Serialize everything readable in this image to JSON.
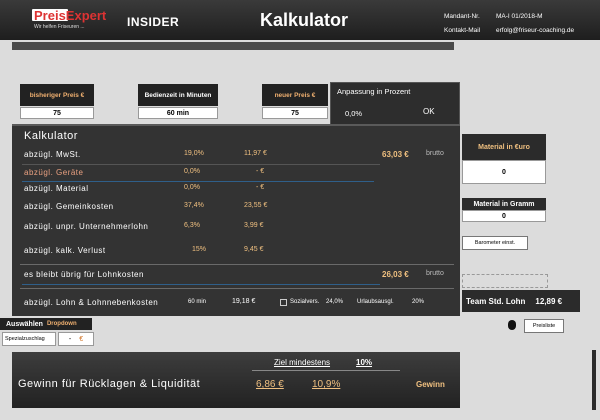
{
  "header": {
    "logo_text": "PreisExpert",
    "logo_tagline": "Wir helfen Friseuren ...",
    "insider": "INSIDER",
    "title": "Kalkulator",
    "mandant_label": "Mandant-Nr.",
    "mandant_value": "MA-I 01/2018-M",
    "contact_label": "Kontakt-Mail",
    "contact_value": "erfolg@friseur-coaching.de"
  },
  "inputs": {
    "bisheriger_preis_label": "bisheriger Preis €",
    "bisheriger_preis_value": "75",
    "bedienzeit_label": "Bedienzeit in Minuten",
    "bedienzeit_value": "60 min",
    "neuer_preis_label": "neuer Preis €",
    "neuer_preis_value": "75",
    "anpassung_label": "Anpassung in Prozent",
    "anpassung_value": "0,0%",
    "ok_label": "OK"
  },
  "calc": {
    "title": "Kalkulator",
    "rows": [
      {
        "name": "abzügl. MwSt.",
        "pct": "19,0%",
        "val": "11,97 €"
      },
      {
        "name": "abzügl. Geräte",
        "pct": "0,0%",
        "val": "- €"
      },
      {
        "name": "abzügl. Material",
        "pct": "0,0%",
        "val": "- €"
      },
      {
        "name": "abzügl. Gemeinkosten",
        "pct": "37,4%",
        "val": "23,55 €"
      },
      {
        "name": "abzügl. unpr. Unternehmerlohn",
        "pct": "6,3%",
        "val": "3,99 €"
      },
      {
        "name": "abzügl. kalk. Verlust",
        "pct": "15%",
        "val": "9,45 €"
      }
    ],
    "netto_value": "63,03 €",
    "netto_label": "brutto",
    "rest_label": "es bleibt übrig für Lohnkosten",
    "rest_value": "26,03 €",
    "rest_tag": "brutto",
    "lohn_label": "abzügl. Lohn & Lohnnebenkosten",
    "lohn_min": "60 min",
    "lohn_value": "19,18 €",
    "sozial_label": "Sozialvers.",
    "sozial_value": "24,0%",
    "urlaub_label": "Urlaubsausgl.",
    "urlaub_value": "20%"
  },
  "right": {
    "material_euro_label": "Material in €uro",
    "material_euro_value": "0",
    "material_gramm_label": "Material in Gramm",
    "material_gramm_value": "0",
    "barometer_button": "Barometer einst.",
    "team_lohn_label": "Team Std. Lohn",
    "team_lohn_value": "12,89 €",
    "preisliste_button": "Preisliste"
  },
  "left_bottom": {
    "auswahlen_label": "Auswählen",
    "dropdown_label": "Dropdown",
    "spezial_label": "Spezialzuschlag",
    "spezial_value": "-",
    "spezial_unit": "€"
  },
  "bottom": {
    "ziel_label": "Ziel mindestens",
    "ziel_value": "10%",
    "gewinn_label": "Gewinn für Rücklagen & Liquidität",
    "gewinn_value": "6,86 €",
    "gewinn_pct": "10,9%",
    "gewinn_tag": "Gewinn"
  }
}
